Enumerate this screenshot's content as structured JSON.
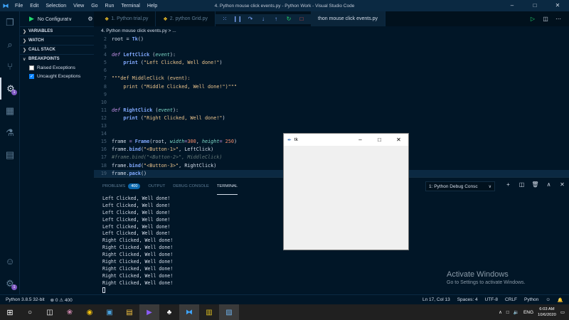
{
  "titlebar": {
    "menu": [
      "File",
      "Edit",
      "Selection",
      "View",
      "Go",
      "Run",
      "Terminal",
      "Help"
    ],
    "window_title": "4. Python mouse click events.py - Python Work - Visual Studio Code",
    "minimize": "–",
    "maximize": "□",
    "close": "✕"
  },
  "debug": {
    "config_label": "No Configurat∨"
  },
  "sidebar": {
    "sections": [
      "VARIABLES",
      "WATCH",
      "CALL STACK",
      "BREAKPOINTS"
    ],
    "breakpoints": [
      {
        "label": "Raised Exceptions",
        "checked": false
      },
      {
        "label": "Uncaught Exceptions",
        "checked": true
      }
    ]
  },
  "activity": {
    "debug_badge": "1",
    "settings_badge": "1"
  },
  "tabs": [
    {
      "label": "1. Python trial.py",
      "active": false
    },
    {
      "label": "2. python Grid.py",
      "active": false
    },
    {
      "label": "thon mouse click events.py",
      "active": true
    }
  ],
  "tab_close": "✕",
  "breadcrumb": "4. Python mouse click events.py > ...",
  "editor": {
    "lines": [
      {
        "n": "2",
        "html": "root = <span class='fn'>Tk</span>()"
      },
      {
        "n": "3",
        "html": ""
      },
      {
        "n": "4",
        "html": "<span class='kw'>def</span> <span class='fn'>LeftClick</span> (<span class='pm'>event</span>):"
      },
      {
        "n": "5",
        "html": "    <span class='fn'>print</span> (<span class='str'>\"Left Clicked, Well done!\"</span>)"
      },
      {
        "n": "6",
        "html": ""
      },
      {
        "n": "7",
        "html": "<span class='str'>\"\"\"def MiddleClick (event):</span>"
      },
      {
        "n": "8",
        "html": "<span class='str'>    print (\"Middle Clicked, Well done!\")\"\"\"</span>"
      },
      {
        "n": "9",
        "html": ""
      },
      {
        "n": "10",
        "html": ""
      },
      {
        "n": "11",
        "html": "<span class='kw'>def</span> <span class='fn'>RightClick</span> (<span class='pm'>event</span>):"
      },
      {
        "n": "12",
        "html": "    <span class='fn'>print</span> (<span class='str'>\"Right Clicked, Well done!\"</span>)"
      },
      {
        "n": "13",
        "html": ""
      },
      {
        "n": "14",
        "html": ""
      },
      {
        "n": "15",
        "html": "frame <span class='op'>=</span> <span class='fn'>Frame</span>(root, <span class='pm'>width</span><span class='op'>=</span><span class='num'>300</span>, <span class='pm'>height</span><span class='op'>=</span> <span class='num'>250</span>)"
      },
      {
        "n": "16",
        "html": "frame.<span class='fn'>bind</span>(<span class='str'>\"&lt;Button-1&gt;\"</span>, LeftClick)"
      },
      {
        "n": "17",
        "html": "<span class='cm'>#frame.bind(\"&lt;Button-2&gt;\", MiddleClick)</span>"
      },
      {
        "n": "18",
        "html": "frame.<span class='fn'>bind</span>(<span class='str'>\"&lt;Button-3&gt;\"</span>, RightClick)"
      },
      {
        "n": "19",
        "html": "frame.<span class='fn'>pack</span>()"
      },
      {
        "n": "20",
        "html": ""
      },
      {
        "n": "21",
        "html": ""
      }
    ]
  },
  "panel": {
    "tabs": [
      {
        "label": "PROBLEMS",
        "count": "400"
      },
      {
        "label": "OUTPUT",
        "count": ""
      },
      {
        "label": "DEBUG CONSOLE",
        "count": ""
      },
      {
        "label": "TERMINAL",
        "count": "",
        "active": true
      }
    ],
    "terminal_select": "1: Python Debug Consc",
    "terminal_lines": [
      "Left Clicked, Well done!",
      "Left Clicked, Well done!",
      "Left Clicked, Well done!",
      "Left Clicked, Well done!",
      "Left Clicked, Well done!",
      "Left Clicked, Well done!",
      "Right Clicked, Well done!",
      "Right Clicked, Well done!",
      "Right Clicked, Well done!",
      "Right Clicked, Well done!",
      "Right Clicked, Well done!",
      "Right Clicked, Well done!",
      "Right Clicked, Well done!"
    ]
  },
  "activate": {
    "title": "Activate Windows",
    "sub": "Go to Settings to activate Windows."
  },
  "tk_window": {
    "title": "tk"
  },
  "status": {
    "python": "Python 3.8.5 32-bit",
    "problems": "⊗ 0 ⚠ 400",
    "position": "Ln 17, Col 13",
    "spaces": "Spaces: 4",
    "encoding": "UTF-8",
    "eol": "CRLF",
    "language": "Python"
  },
  "taskbar": {
    "lang": "ENG",
    "time": "6:03 AM",
    "date": "10/6/2020"
  }
}
